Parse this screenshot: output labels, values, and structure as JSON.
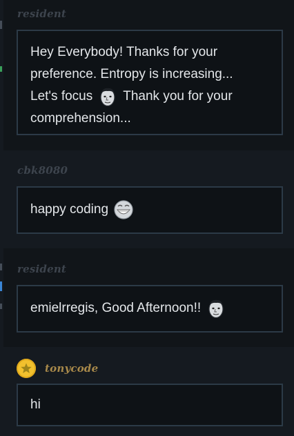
{
  "messages": [
    {
      "author": "resident",
      "lines": [
        "Hey Everybody! Thanks for your",
        "preference. Entropy is increasing...",
        "Let's focus",
        "Thank you for your",
        "comprehension..."
      ],
      "emoji": "face-icon"
    },
    {
      "author": "cbk8080",
      "text": "happy coding",
      "emoji": "grin-icon"
    },
    {
      "author": "resident",
      "text": "emielrregis, Good Afternoon!!",
      "emoji": "face-icon"
    },
    {
      "author": "tonycode",
      "text": "hi",
      "avatar": "star-avatar-icon"
    }
  ],
  "colors": {
    "author_muted": "#3d444d",
    "author_highlight": "#a8894a",
    "bubble_border": "#2c3a47",
    "avatar": "#f2c12e"
  }
}
